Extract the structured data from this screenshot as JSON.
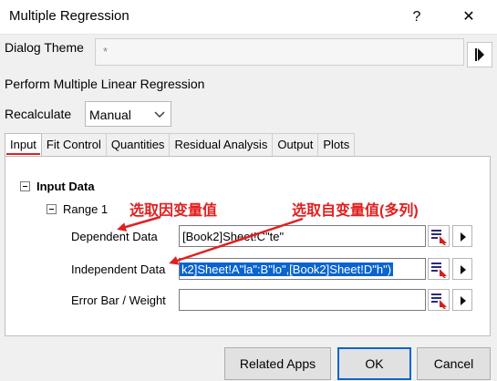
{
  "window": {
    "title": "Multiple Regression",
    "help_glyph": "?",
    "close_glyph": "✕"
  },
  "theme": {
    "label": "Dialog Theme",
    "value": "*"
  },
  "description": "Perform Multiple Linear Regression",
  "recalculate": {
    "label": "Recalculate",
    "value": "Manual"
  },
  "tabs": [
    {
      "label": "Input"
    },
    {
      "label": "Fit Control"
    },
    {
      "label": "Quantities"
    },
    {
      "label": "Residual Analysis"
    },
    {
      "label": "Output"
    },
    {
      "label": "Plots"
    }
  ],
  "tree": {
    "group": "Input Data",
    "range": "Range 1",
    "rows": [
      {
        "label": "Dependent Data",
        "value": "[Book2]Sheet!C\"te\""
      },
      {
        "label": "Independent Data",
        "value": "k2]Sheet!A\"la\":B\"lo\",[Book2]Sheet!D\"h\")"
      },
      {
        "label": "Error Bar / Weight",
        "value": ""
      }
    ]
  },
  "annotations": {
    "dependent": "选取因变量值",
    "independent": "选取自变量值(多列)"
  },
  "buttons": {
    "related": "Related Apps",
    "ok": "OK",
    "cancel": "Cancel"
  },
  "colors": {
    "annotation": "#e02020",
    "selection": "#0a64d0",
    "active_tab_underline": "#e02020"
  }
}
